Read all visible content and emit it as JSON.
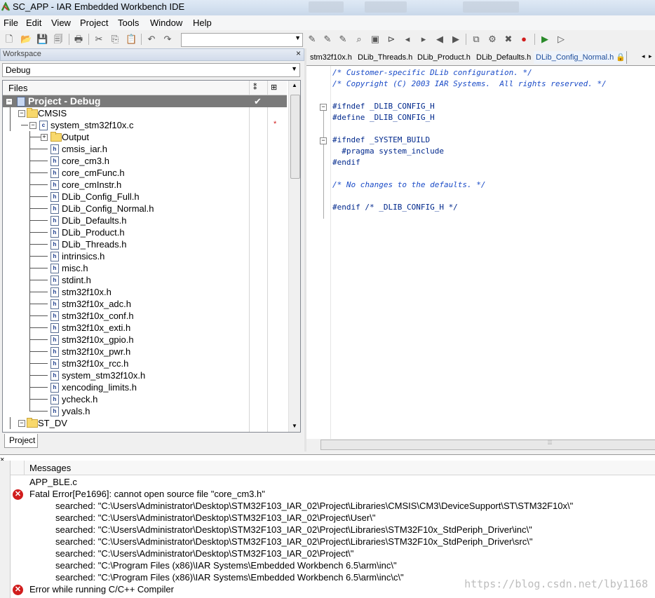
{
  "window": {
    "title": "SC_APP - IAR Embedded Workbench IDE"
  },
  "menu": [
    "File",
    "Edit",
    "View",
    "Project",
    "Tools",
    "Window",
    "Help"
  ],
  "workspace": {
    "header": "Workspace",
    "close": "×",
    "config": "Debug",
    "files_header": "Files",
    "tab": "Project"
  },
  "tree": [
    {
      "label": "Project - Debug",
      "type": "project",
      "depth": 0
    },
    {
      "label": "CMSIS",
      "type": "folder",
      "depth": 1
    },
    {
      "label": "system_stm32f10x.c",
      "type": "c",
      "depth": 2,
      "marker": "*"
    },
    {
      "label": "Output",
      "type": "folder",
      "depth": 3
    },
    {
      "label": "cmsis_iar.h",
      "type": "h",
      "depth": 3
    },
    {
      "label": "core_cm3.h",
      "type": "h",
      "depth": 3
    },
    {
      "label": "core_cmFunc.h",
      "type": "h",
      "depth": 3
    },
    {
      "label": "core_cmInstr.h",
      "type": "h",
      "depth": 3
    },
    {
      "label": "DLib_Config_Full.h",
      "type": "h",
      "depth": 3
    },
    {
      "label": "DLib_Config_Normal.h",
      "type": "h",
      "depth": 3
    },
    {
      "label": "DLib_Defaults.h",
      "type": "h",
      "depth": 3
    },
    {
      "label": "DLib_Product.h",
      "type": "h",
      "depth": 3
    },
    {
      "label": "DLib_Threads.h",
      "type": "h",
      "depth": 3
    },
    {
      "label": "intrinsics.h",
      "type": "h",
      "depth": 3
    },
    {
      "label": "misc.h",
      "type": "h",
      "depth": 3
    },
    {
      "label": "stdint.h",
      "type": "h",
      "depth": 3
    },
    {
      "label": "stm32f10x.h",
      "type": "h",
      "depth": 3
    },
    {
      "label": "stm32f10x_adc.h",
      "type": "h",
      "depth": 3
    },
    {
      "label": "stm32f10x_conf.h",
      "type": "h",
      "depth": 3
    },
    {
      "label": "stm32f10x_exti.h",
      "type": "h",
      "depth": 3
    },
    {
      "label": "stm32f10x_gpio.h",
      "type": "h",
      "depth": 3
    },
    {
      "label": "stm32f10x_pwr.h",
      "type": "h",
      "depth": 3
    },
    {
      "label": "stm32f10x_rcc.h",
      "type": "h",
      "depth": 3
    },
    {
      "label": "system_stm32f10x.h",
      "type": "h",
      "depth": 3
    },
    {
      "label": "xencoding_limits.h",
      "type": "h",
      "depth": 3
    },
    {
      "label": "ycheck.h",
      "type": "h",
      "depth": 3
    },
    {
      "label": "yvals.h",
      "type": "h",
      "depth": 3
    },
    {
      "label": "ST_DV",
      "type": "folder",
      "depth": 1
    }
  ],
  "editor": {
    "tabs": [
      {
        "label": "stm32f10x.h",
        "active": false
      },
      {
        "label": "DLib_Threads.h",
        "active": false
      },
      {
        "label": "DLib_Product.h",
        "active": false
      },
      {
        "label": "DLib_Defaults.h",
        "active": false
      },
      {
        "label": "DLib_Config_Normal.h",
        "active": true
      }
    ],
    "code": [
      {
        "text": "/* Customer-specific DLib configuration. */",
        "kind": "cmt"
      },
      {
        "text": "/* Copyright (C) 2003 IAR Systems.  All rights reserved. */",
        "kind": "cmt"
      },
      {
        "text": "",
        "kind": "plain"
      },
      {
        "text": "#ifndef _DLIB_CONFIG_H",
        "kind": "pp"
      },
      {
        "text": "#define _DLIB_CONFIG_H",
        "kind": "pp"
      },
      {
        "text": "",
        "kind": "plain"
      },
      {
        "text": "#ifndef _SYSTEM_BUILD",
        "kind": "pp"
      },
      {
        "text": "  #pragma system_include",
        "kind": "pp"
      },
      {
        "text": "#endif",
        "kind": "pp"
      },
      {
        "text": "",
        "kind": "plain"
      },
      {
        "text": "/* No changes to the defaults. */",
        "kind": "cmt"
      },
      {
        "text": "",
        "kind": "plain"
      },
      {
        "text": "#endif /* _DLIB_CONFIG_H */",
        "kind": "pp"
      }
    ]
  },
  "messages": {
    "close": "×",
    "header": "Messages",
    "lines": [
      {
        "text": "APP_BLE.c",
        "icon": "",
        "indent": false
      },
      {
        "text": "Fatal Error[Pe1696]: cannot open source file \"core_cm3.h\"",
        "icon": "error",
        "indent": false
      },
      {
        "text": "searched: \"C:\\Users\\Administrator\\Desktop\\STM32F103_IAR_02\\Project\\Libraries\\CMSIS\\CM3\\DeviceSupport\\ST\\STM32F10x\\\"",
        "icon": "",
        "indent": true
      },
      {
        "text": "searched: \"C:\\Users\\Administrator\\Desktop\\STM32F103_IAR_02\\Project\\User\\\"",
        "icon": "",
        "indent": true
      },
      {
        "text": "searched: \"C:\\Users\\Administrator\\Desktop\\STM32F103_IAR_02\\Project\\Libraries\\STM32F10x_StdPeriph_Driver\\inc\\\"",
        "icon": "",
        "indent": true
      },
      {
        "text": "searched: \"C:\\Users\\Administrator\\Desktop\\STM32F103_IAR_02\\Project\\Libraries\\STM32F10x_StdPeriph_Driver\\src\\\"",
        "icon": "",
        "indent": true
      },
      {
        "text": "searched: \"C:\\Users\\Administrator\\Desktop\\STM32F103_IAR_02\\Project\\\"",
        "icon": "",
        "indent": true
      },
      {
        "text": "searched: \"C:\\Program Files (x86)\\IAR Systems\\Embedded Workbench 6.5\\arm\\inc\\\"",
        "icon": "",
        "indent": true
      },
      {
        "text": "searched: \"C:\\Program Files (x86)\\IAR Systems\\Embedded Workbench 6.5\\arm\\inc\\c\\\"",
        "icon": "",
        "indent": true
      },
      {
        "text": "Error while running C/C++ Compiler",
        "icon": "error",
        "indent": false
      }
    ],
    "watermark": "https://blog.csdn.net/lby1168"
  }
}
